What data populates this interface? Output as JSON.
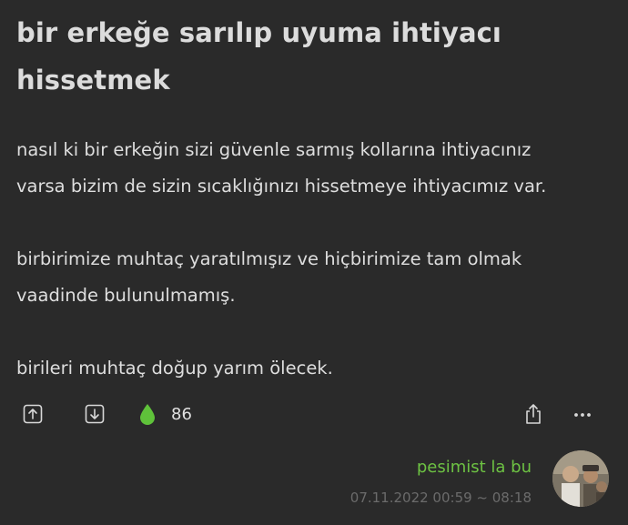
{
  "entry": {
    "title_line1": "bir erkeğe sarılıp uyuma ihtiyacı",
    "title_line2": "hissetmek",
    "paragraphs": [
      "nasıl ki bir erkeğin sizi güvenle sarmış kollarına ihtiyacınız varsa bizim de sizin sıcaklığınızı hissetmeye ihtiyacımız var.",
      "birbirimize muhtaç yaratılmışız ve hiçbirimize tam olmak vaadinde bulunulmamış.",
      "birileri muhtaç doğup yarım ölecek."
    ],
    "body_lines": {
      "p1_l1": "nasıl ki bir erkeğin sizi güvenle sarmış kollarına ihtiyacınız",
      "p1_l2": "varsa bizim de sizin sıcaklığınızı hissetmeye ihtiyacımız var.",
      "p2_l1": "birbirimize muhtaç yaratılmışız ve hiçbirimize tam olmak",
      "p2_l2": "vaadinde bulunulmamış.",
      "p3_l1": "birileri muhtaç doğup yarım ölecek."
    }
  },
  "actions": {
    "upvote_icon": "upvote-arrow-icon",
    "downvote_icon": "downvote-arrow-icon",
    "favorite_icon": "drop-icon",
    "favorite_count": "86",
    "share_icon": "share-icon",
    "more_icon": "more-dots-icon"
  },
  "meta": {
    "author": "pesimist la bu",
    "date": "07.11.2022 00:59 ~ 08:18"
  },
  "colors": {
    "background": "#2a2a2a",
    "text": "#dedede",
    "accent_green": "#6dc243",
    "muted": "#6b6b6b"
  }
}
